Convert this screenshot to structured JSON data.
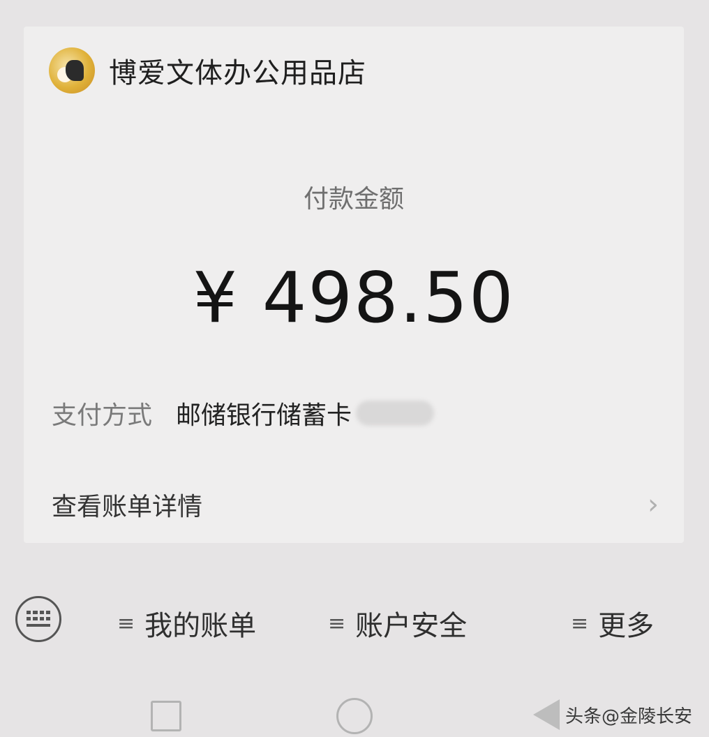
{
  "merchant": {
    "name": "博爱文体办公用品店",
    "avatar_icon": "merchant-avatar"
  },
  "payment": {
    "amount_label": "付款金额",
    "amount": "¥ 498.50",
    "method_label": "支付方式",
    "method_value": "邮储银行储蓄卡"
  },
  "bill_details": {
    "label": "查看账单详情",
    "chevron": "›"
  },
  "bottom_menu": {
    "keyboard_icon": "keyboard-icon",
    "items": [
      {
        "icon": "≡",
        "label": "我的账单"
      },
      {
        "icon": "≡",
        "label": "账户安全"
      },
      {
        "icon": "≡",
        "label": "更多"
      }
    ]
  },
  "watermark": "头条@金陵长安",
  "colors": {
    "background": "#e6e4e5",
    "card": "#efeeee",
    "text": "#2a2a2a"
  }
}
